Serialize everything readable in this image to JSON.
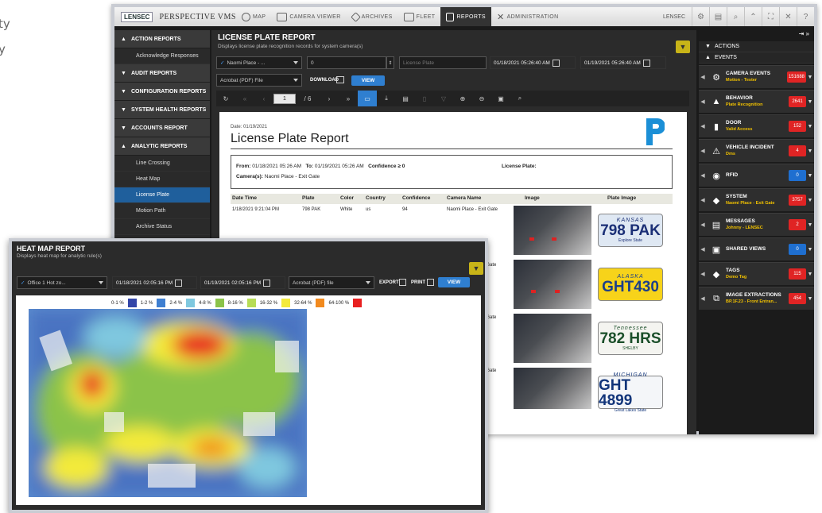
{
  "bg_text": [
    "ty",
    "y"
  ],
  "topbar": {
    "logo": "LENSEC",
    "brand": "PERSPECTIVE VMS",
    "nav": [
      {
        "label": "MAP",
        "icon": "globe-icon"
      },
      {
        "label": "CAMERA VIEWER",
        "icon": "monitor-icon"
      },
      {
        "label": "ARCHIVES",
        "icon": "archive-icon"
      },
      {
        "label": "FLEET",
        "icon": "bus-icon"
      },
      {
        "label": "REPORTS",
        "icon": "report-icon"
      },
      {
        "label": "ADMINISTRATION",
        "icon": "tools-icon"
      }
    ],
    "user": "LENSEC"
  },
  "sidebar": {
    "sections": [
      {
        "label": "ACTION REPORTS",
        "expanded": true,
        "items": [
          "Acknowledge Responses"
        ]
      },
      {
        "label": "AUDIT REPORTS",
        "expanded": false,
        "items": []
      },
      {
        "label": "CONFIGURATION REPORTS",
        "expanded": false,
        "items": []
      },
      {
        "label": "SYSTEM HEALTH REPORTS",
        "expanded": false,
        "items": []
      },
      {
        "label": "ACCOUNTS REPORT",
        "expanded": false,
        "items": []
      },
      {
        "label": "ANALYTIC REPORTS",
        "expanded": true,
        "items": [
          "Line Crossing",
          "Heat Map",
          "License Plate",
          "Motion Path",
          "Archive Status",
          "Archive History"
        ]
      }
    ],
    "active_item": "License Plate"
  },
  "lpr": {
    "title": "LICENSE PLATE REPORT",
    "subtitle": "Displays license plate recognition records for system camera(s)",
    "camera_select": "Naomi Place - ...",
    "confidence": "0",
    "plate_placeholder": "License Plate",
    "from": "01/18/2021 05:26:40 AM",
    "to": "01/19/2021 05:26:40 AM",
    "format": "Acrobat (PDF) File",
    "download_label": "DOWNLOAD",
    "view_label": "VIEW",
    "page_current": "1",
    "page_total": "/ 6"
  },
  "report": {
    "date_label": "Date:",
    "date": "01/19/2021",
    "title": "License Plate Report",
    "from_label": "From:",
    "from": "01/18/2021 05:26 AM",
    "to_label": "To:",
    "to": "01/19/2021 05:26 AM",
    "confidence_label": "Confidence ≥ 0",
    "plate_label": "License Plate:",
    "cameras_label": "Camera(s):",
    "cameras": "Naomi Place - Exit Gate",
    "columns": [
      "Date Time",
      "Plate",
      "Color",
      "Country",
      "Confidence",
      "Camera Name",
      "Image",
      "Plate Image"
    ],
    "row": [
      "1/18/2021 9:21:04 PM",
      "798 PAK",
      "White",
      "us",
      "94",
      "Naomi Place - Exit Gate"
    ],
    "partial_camera": "- Exit Gate",
    "plates": [
      {
        "state": "KANSAS",
        "number": "798 PAK",
        "bottom": "Explore State",
        "bg": "#dfe8f3",
        "fg": "#1b2f76",
        "tag": "56"
      },
      {
        "state": "ALASKA",
        "number": "GHT430",
        "bottom": "",
        "bg": "#f7d31a",
        "fg": "#1b3e8a",
        "tag": ""
      },
      {
        "state": "Tennessee",
        "number": "782 HRS",
        "bottom": "SHELBY",
        "bg": "#f4f4f0",
        "fg": "#1b4f2a",
        "tag": "FEB"
      },
      {
        "state": "MICHIGAN",
        "number": "GHT 4899",
        "bottom": "Great Lakes State",
        "bg": "#f4f6f9",
        "fg": "#12357a",
        "tag": ""
      }
    ]
  },
  "rpanel": {
    "actions_label": "ACTIONS",
    "events_label": "EVENTS",
    "events": [
      {
        "name": "CAMERA EVENTS",
        "sub": "Motion - Tester",
        "count": "151688",
        "color": "#e02424",
        "icon": "camera-event-icon"
      },
      {
        "name": "BEHAVIOR",
        "sub": "Plate Recognition",
        "count": "2641",
        "color": "#e02424",
        "icon": "warning-icon"
      },
      {
        "name": "DOOR",
        "sub": "Valid Access",
        "count": "152",
        "color": "#e02424",
        "icon": "door-icon"
      },
      {
        "name": "VEHICLE INCIDENT",
        "sub": "Dms",
        "count": "4",
        "color": "#e02424",
        "icon": "vehicle-incident-icon"
      },
      {
        "name": "RFID",
        "sub": "",
        "count": "0",
        "color": "#1f6fd0",
        "icon": "rfid-icon"
      },
      {
        "name": "SYSTEM",
        "sub": "Naomi Place - Exit Gate",
        "count": "3757",
        "color": "#e02424",
        "icon": "system-icon"
      },
      {
        "name": "MESSAGES",
        "sub": "Johnny - LENSEC",
        "count": "2",
        "color": "#e02424",
        "icon": "message-icon"
      },
      {
        "name": "SHARED VIEWS",
        "sub": "",
        "count": "0",
        "color": "#1f6fd0",
        "icon": "shared-views-icon"
      },
      {
        "name": "TAGS",
        "sub": "Demo Tag",
        "count": "115",
        "color": "#e02424",
        "icon": "tag-icon"
      },
      {
        "name": "IMAGE EXTRACTIONS",
        "sub": "BP.1F.23 - Front Entran...",
        "count": "454",
        "color": "#e02424",
        "icon": "image-extraction-icon"
      }
    ]
  },
  "heatmap": {
    "title": "HEAT MAP REPORT",
    "subtitle": "Displays heat map for analytic rule(s)",
    "camera": "Office 1 Hot zo...",
    "from": "01/18/2021 02:05:16 PM",
    "to": "01/19/2021 02:05:16 PM",
    "format": "Acrobat (PDF) file",
    "export_label": "EXPORT",
    "print_label": "PRINT",
    "view_label": "VIEW",
    "legend": [
      {
        "label": "0-1 %",
        "color": "#3346a8"
      },
      {
        "label": "1-2 %",
        "color": "#3f7fd1"
      },
      {
        "label": "2-4 %",
        "color": "#7fc8df"
      },
      {
        "label": "4-8 %",
        "color": "#8bc34a"
      },
      {
        "label": "8-16 %",
        "color": "#b7dc56"
      },
      {
        "label": "16-32 %",
        "color": "#f3ea3b"
      },
      {
        "label": "32-64 %",
        "color": "#f28a1e"
      },
      {
        "label": "64-100 %",
        "color": "#e82020"
      }
    ]
  }
}
